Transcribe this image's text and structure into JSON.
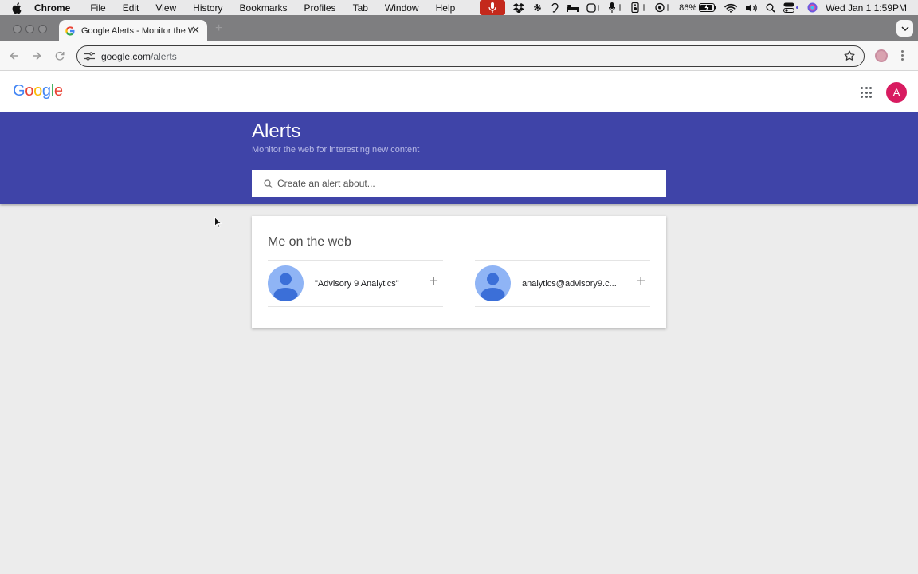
{
  "menubar": {
    "app": "Chrome",
    "items": [
      "File",
      "Edit",
      "View",
      "History",
      "Bookmarks",
      "Profiles",
      "Tab",
      "Window",
      "Help"
    ],
    "battery": "86%",
    "datetime": "Wed Jan 1  1:59PM"
  },
  "browser": {
    "tab_title": "Google Alerts - Monitor the Web",
    "url_host": "google.com",
    "url_path": "/alerts"
  },
  "header": {
    "logo_letters": [
      "G",
      "o",
      "o",
      "g",
      "l",
      "e"
    ],
    "avatar_initial": "A"
  },
  "banner": {
    "title": "Alerts",
    "subtitle": "Monitor the web for interesting new content",
    "search_placeholder": "Create an alert about..."
  },
  "card": {
    "title": "Me on the web",
    "suggestions": [
      {
        "label": "\"Advisory 9 Analytics\""
      },
      {
        "label": "analytics@advisory9.c..."
      }
    ]
  },
  "colors": {
    "banner": "#3f44a8",
    "avatar": "#d81b60",
    "mic_pill": "#c4291c"
  }
}
